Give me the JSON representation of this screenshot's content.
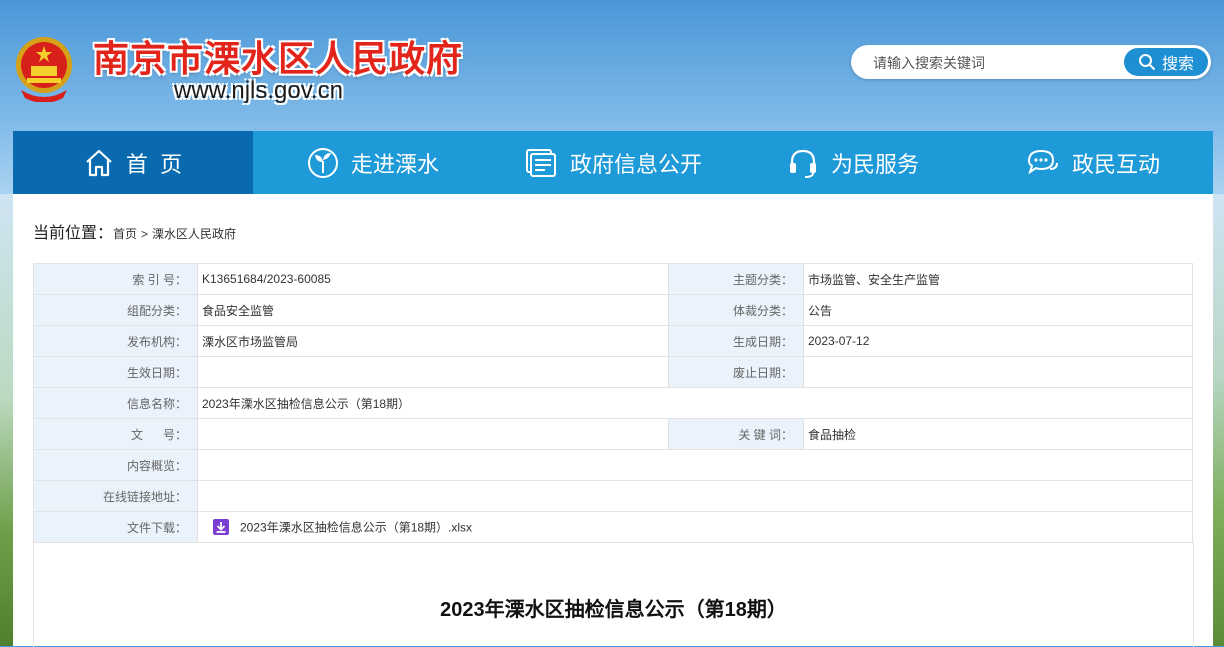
{
  "header": {
    "site_title": "南京市溧水区人民政府",
    "site_url": "www.njls.gov.cn",
    "search_placeholder": "请输入搜索关键词",
    "search_button": "搜索"
  },
  "nav": {
    "items": [
      {
        "label": "首  页",
        "icon": "home-icon"
      },
      {
        "label": "走进溧水",
        "icon": "sprout-icon"
      },
      {
        "label": "政府信息公开",
        "icon": "document-icon"
      },
      {
        "label": "为民服务",
        "icon": "headset-icon"
      },
      {
        "label": "政民互动",
        "icon": "chat-icon"
      }
    ],
    "active_index": 0
  },
  "breadcrumb": {
    "label": "当前位置：",
    "items": [
      "首页",
      "溧水区人民政府"
    ],
    "separator": ">"
  },
  "meta": {
    "index_no_label": "索 引 号：",
    "index_no": "K13651684/2023-60085",
    "topic_label": "主题分类：",
    "topic": "市场监管、安全生产监管",
    "category_label": "组配分类：",
    "category": "食品安全监管",
    "genre_label": "体裁分类：",
    "genre": "公告",
    "publisher_label": "发布机构：",
    "publisher": "溧水区市场监管局",
    "created_label": "生成日期：",
    "created": "2023-07-12",
    "effective_label": "生效日期：",
    "effective": "",
    "expiry_label": "废止日期：",
    "expiry": "",
    "info_name_label": "信息名称：",
    "info_name": "2023年溧水区抽检信息公示（第18期）",
    "doc_no_label": "文      号：",
    "doc_no": "",
    "keywords_label": "关 键 词：",
    "keywords": "食品抽检",
    "summary_label": "内容概览：",
    "summary": "",
    "link_label": "在线链接地址：",
    "link": "",
    "download_label": "文件下载：",
    "download_file": "2023年溧水区抽检信息公示（第18期）.xlsx"
  },
  "article": {
    "title": "2023年溧水区抽检信息公示（第18期）"
  },
  "colors": {
    "nav_bg": "#1e9ad9",
    "nav_active": "#0a6ab0",
    "title_red": "#e2241a",
    "label_bg": "#eaf3fb",
    "download_icon": "#7b3fd1"
  }
}
